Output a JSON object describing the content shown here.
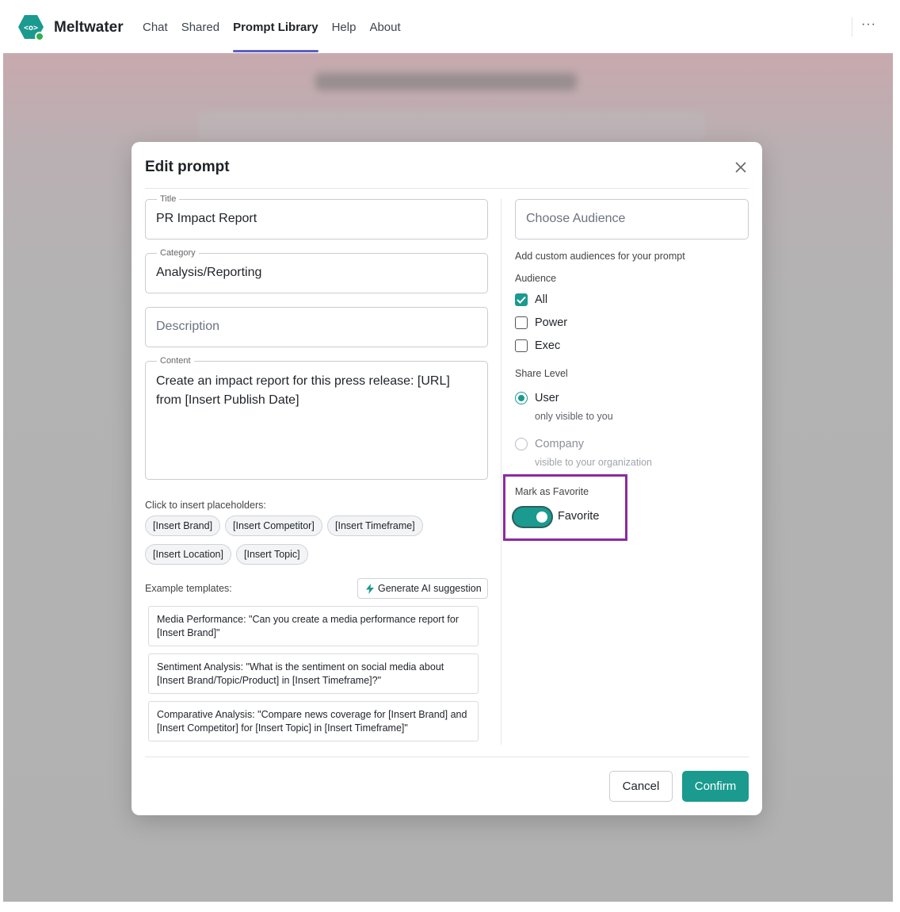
{
  "app": {
    "brand": "Meltwater",
    "logo_icon": "meltwater-logo-icon",
    "more_label": "···"
  },
  "nav": {
    "items": [
      {
        "label": "Chat",
        "active": false
      },
      {
        "label": "Shared",
        "active": false
      },
      {
        "label": "Prompt Library",
        "active": true
      },
      {
        "label": "Help",
        "active": false
      },
      {
        "label": "About",
        "active": false
      }
    ]
  },
  "modal": {
    "title": "Edit prompt",
    "title_field": {
      "legend": "Title",
      "value": "PR Impact Report"
    },
    "category_field": {
      "legend": "Category",
      "value": "Analysis/Reporting"
    },
    "description_field": {
      "placeholder": "Description",
      "value": ""
    },
    "content_field": {
      "legend": "Content",
      "value": "Create an impact report for this press release: [URL] from [Insert Publish Date]"
    },
    "placeholders_label": "Click to insert placeholders:",
    "placeholders": [
      "[Insert Brand]",
      "[Insert Competitor]",
      "[Insert Timeframe]",
      "[Insert Location]",
      "[Insert Topic]"
    ],
    "examples_label": "Example templates:",
    "generate_button": "Generate AI suggestion",
    "templates": [
      "Media Performance: \"Can you create a media performance report for [Insert Brand]\"",
      "Sentiment Analysis: \"What is the sentiment on social media about [Insert Brand/Topic/Product] in [Insert Timeframe]?\"",
      "Comparative Analysis: \"Compare news coverage for [Insert Brand] and [Insert Competitor] for [Insert Topic] in [Insert Timeframe]\""
    ],
    "audience_picker": {
      "placeholder": "Choose Audience"
    },
    "audience_hint": "Add custom audiences for your prompt",
    "audience_label": "Audience",
    "audiences": [
      {
        "label": "All",
        "checked": true
      },
      {
        "label": "Power",
        "checked": false
      },
      {
        "label": "Exec",
        "checked": false
      }
    ],
    "share_level_label": "Share Level",
    "share_levels": [
      {
        "label": "User",
        "sub": "only visible to you",
        "selected": true,
        "disabled": false
      },
      {
        "label": "Company",
        "sub": "visible to your organization",
        "selected": false,
        "disabled": true
      }
    ],
    "favorite_label": "Mark as Favorite",
    "favorite_toggle_label": "Favorite",
    "favorite_on": true,
    "cancel_label": "Cancel",
    "confirm_label": "Confirm"
  },
  "colors": {
    "accent": "#1b9a8f",
    "nav_underline": "#5b5fc7",
    "highlight_box": "#8c2ba0"
  }
}
